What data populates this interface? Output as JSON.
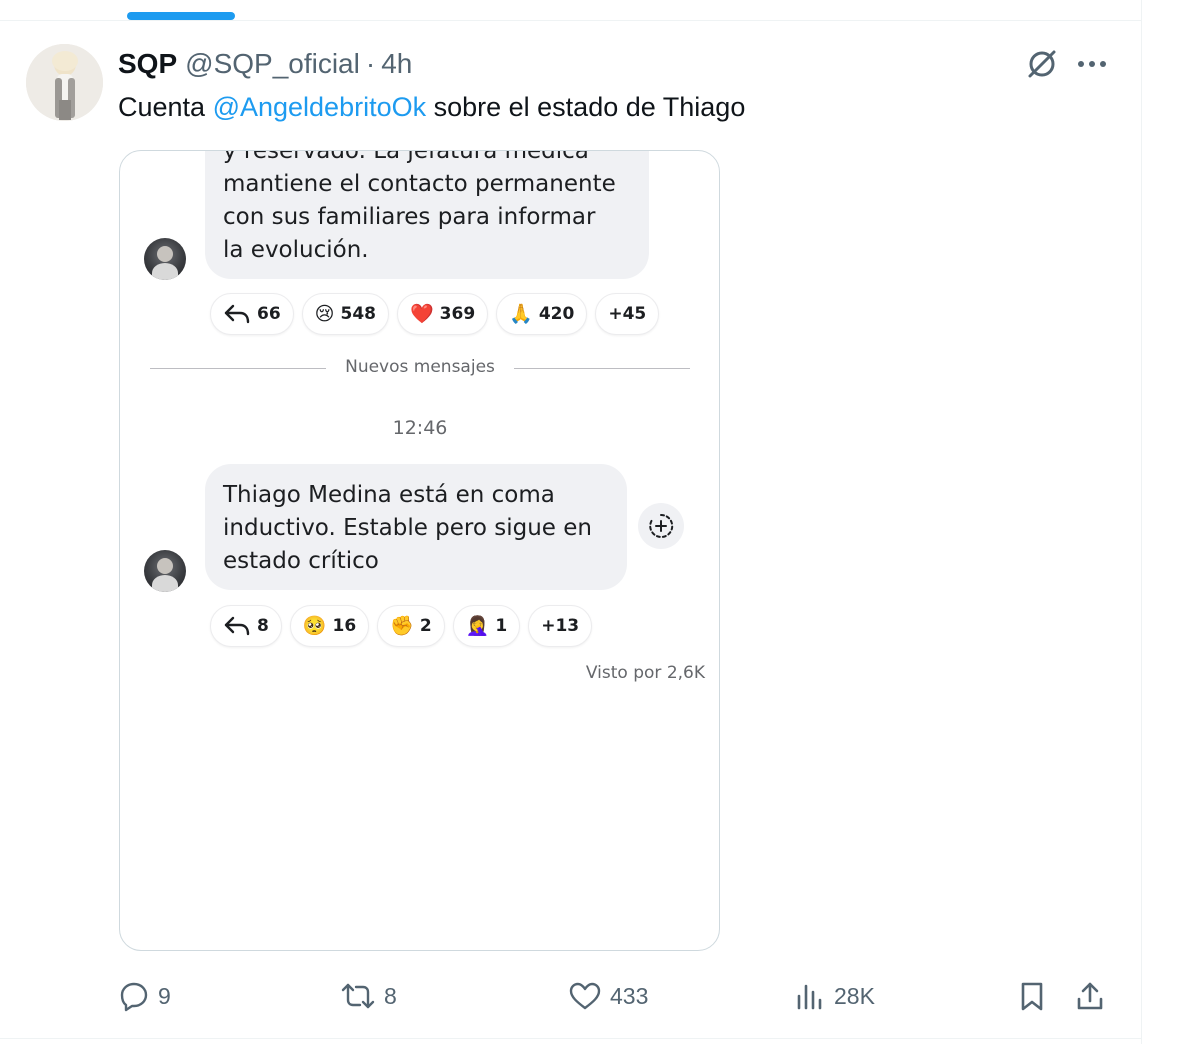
{
  "tweet": {
    "author_name": "SQP",
    "author_handle": "@SQP_oficial",
    "separator": "·",
    "time": "4h",
    "text_before": "Cuenta ",
    "mention": "@AngeldebritoOk",
    "text_after": " sobre el estado de Thiago"
  },
  "media": {
    "message_1_lines": [
      "y reservado. La jefatura médica",
      "mantiene el contacto permanente",
      "con sus familiares para informar",
      "la evolución."
    ],
    "message_1_reactions": [
      {
        "icon": "reply-arrow",
        "count": "66"
      },
      {
        "icon": "crying-face",
        "emoji": "😢",
        "count": "548"
      },
      {
        "icon": "red-heart",
        "emoji": "❤️",
        "count": "369"
      },
      {
        "icon": "folded-hands",
        "emoji": "🙏",
        "count": "420"
      },
      {
        "icon": "more",
        "count": "+45"
      }
    ],
    "divider_label": "Nuevos mensajes",
    "timestamp": "12:46",
    "message_2_lines": [
      "Thiago Medina está en coma",
      "inductivo. Estable pero sigue en",
      "estado crítico"
    ],
    "message_2_reactions": [
      {
        "icon": "reply-arrow",
        "count": "8"
      },
      {
        "icon": "pleading-face",
        "emoji": "🥺",
        "count": "16"
      },
      {
        "icon": "raised-fist",
        "emoji": "✊",
        "count": "2"
      },
      {
        "icon": "facepalm",
        "emoji": "🤦‍♀️",
        "count": "1"
      },
      {
        "icon": "more",
        "count": "+13"
      }
    ],
    "seen_by": "Visto por 2,6K"
  },
  "actions": {
    "replies": "9",
    "reposts": "8",
    "likes": "433",
    "views": "28K"
  },
  "colors": {
    "accent": "#1d9bf0",
    "secondary_text": "#536471",
    "border": "#cfd9de",
    "heart": "#f22c3d"
  }
}
